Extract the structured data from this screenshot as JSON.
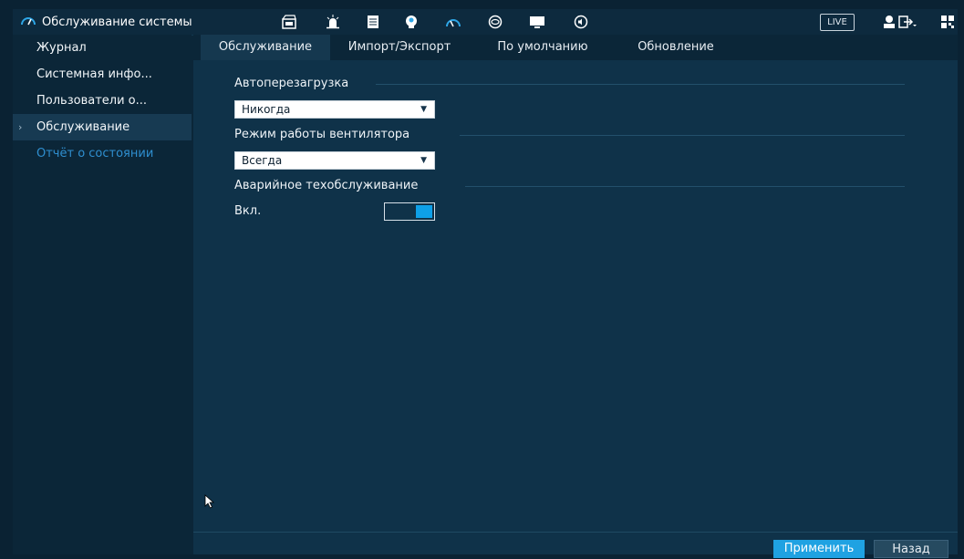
{
  "window": {
    "title": "Обслуживание системы"
  },
  "topbar": {
    "icons": [
      "gauge-icon",
      "camera-settings-icon",
      "alarm-icon",
      "storage-icon",
      "ai-face-icon",
      "gauge-icon",
      "network-icon",
      "display-icon",
      "audio-icon",
      "user-icon",
      "logout-icon",
      "qr-code-icon"
    ],
    "live_label": "LIVE"
  },
  "sidebar": {
    "items": [
      {
        "label": "Журнал"
      },
      {
        "label": "Системная инфо..."
      },
      {
        "label": "Пользователи о..."
      },
      {
        "label": "Обслуживание"
      },
      {
        "label": "Отчёт о состоянии"
      }
    ],
    "active_index": 3
  },
  "tabs": [
    {
      "label": "Обслуживание"
    },
    {
      "label": "Импорт/Экспорт"
    },
    {
      "label": "По умолчанию"
    },
    {
      "label": "Обновление"
    }
  ],
  "sections": {
    "auto_reboot": {
      "title": "Автоперезагрузка",
      "value": "Никогда"
    },
    "fan_mode": {
      "title": "Режим работы вентилятора",
      "value": "Всегда"
    },
    "emergency": {
      "title": "Аварийное техобслуживание",
      "toggle_label": "Вкл.",
      "enabled": true
    }
  },
  "footer": {
    "apply_label": "Применить",
    "back_label": "Назад"
  },
  "colors": {
    "accent": "#1fa2e2",
    "background": "#0f3249",
    "sidebar": "#0b2638"
  }
}
